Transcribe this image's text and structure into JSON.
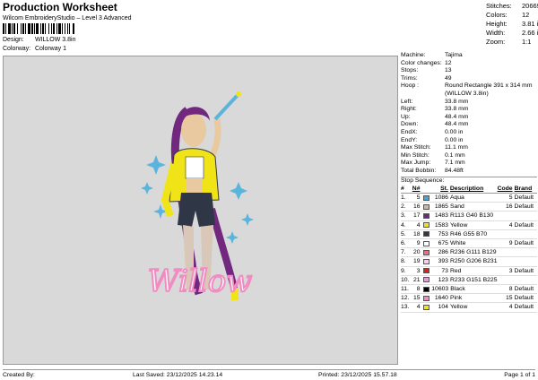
{
  "header": {
    "title": "Production Worksheet",
    "subtitle": "Wilcom EmbroideryStudio – Level 3 Advanced",
    "design_label": "Design:",
    "design_value": "WILLOW 3.8in",
    "colorway_label": "Colorway:",
    "colorway_value": "Colorway 1"
  },
  "summary": [
    {
      "label": "Stitches:",
      "value": "20669"
    },
    {
      "label": "Colors:",
      "value": "12"
    },
    {
      "label": "Height:",
      "value": "3.81 in"
    },
    {
      "label": "Width:",
      "value": "2.66 in"
    },
    {
      "label": "Zoom:",
      "value": "1:1"
    }
  ],
  "properties": [
    {
      "label": "Machine:",
      "value": "Tajima"
    },
    {
      "label": "Color changes:",
      "value": "12"
    },
    {
      "label": "Stops:",
      "value": "13"
    },
    {
      "label": "Trims:",
      "value": "49"
    },
    {
      "label": "Hoop :",
      "value": "Round Rectangle 391 x 314 mm"
    }
  ],
  "hoop_extra": "(WILLOW 3.8in)",
  "properties2": [
    {
      "label": "Left:",
      "value": "33.8 mm"
    },
    {
      "label": "Right:",
      "value": "33.8 mm"
    },
    {
      "label": "Up:",
      "value": "48.4 mm"
    },
    {
      "label": "Down:",
      "value": "48.4 mm"
    },
    {
      "label": "EndX:",
      "value": "0.00 in"
    },
    {
      "label": "EndY:",
      "value": "0.00 in"
    },
    {
      "label": "Max Stitch:",
      "value": "11.1 mm"
    },
    {
      "label": "Min Stitch:",
      "value": "0.1 mm"
    },
    {
      "label": "Max Jump:",
      "value": "7.1 mm"
    },
    {
      "label": "Total Bobbin:",
      "value": "84.48ft"
    }
  ],
  "stop_sequence": {
    "title": "Stop Sequence:",
    "headers": {
      "num": "#",
      "n": "N#",
      "st": "St.",
      "desc": "Description",
      "code": "Code",
      "brand": "Brand"
    },
    "rows": [
      {
        "num": "1.",
        "n": "5",
        "color": "#4aa3d6",
        "st": "1086",
        "desc": "Aqua",
        "code": "5",
        "brand": "Default"
      },
      {
        "num": "2.",
        "n": "16",
        "color": "#c9b89a",
        "st": "1865",
        "desc": "Sand",
        "code": "16",
        "brand": "Default"
      },
      {
        "num": "3.",
        "n": "17",
        "color": "#71287e",
        "st": "1483",
        "desc": "R113 G40 B130",
        "code": "",
        "brand": ""
      },
      {
        "num": "4.",
        "n": "4",
        "color": "#f0e318",
        "st": "1583",
        "desc": "Yellow",
        "code": "4",
        "brand": "Default"
      },
      {
        "num": "5.",
        "n": "18",
        "color": "#2f3746",
        "st": "753",
        "desc": "R46 G55 B70",
        "code": "",
        "brand": ""
      },
      {
        "num": "6.",
        "n": "9",
        "color": "#ffffff",
        "st": "675",
        "desc": "White",
        "code": "9",
        "brand": "Default"
      },
      {
        "num": "7.",
        "n": "20",
        "color": "#ec6f81",
        "st": "286",
        "desc": "R236 G111 B129",
        "code": "",
        "brand": ""
      },
      {
        "num": "8.",
        "n": "19",
        "color": "#facee7",
        "st": "393",
        "desc": "R250 G206 B231",
        "code": "",
        "brand": ""
      },
      {
        "num": "9.",
        "n": "3",
        "color": "#d9201f",
        "st": "73",
        "desc": "Red",
        "code": "3",
        "brand": "Default"
      },
      {
        "num": "10.",
        "n": "21",
        "color": "#e997e1",
        "st": "123",
        "desc": "R233 G151 B225",
        "code": "",
        "brand": ""
      },
      {
        "num": "11.",
        "n": "8",
        "color": "#000000",
        "st": "10603",
        "desc": "Black",
        "code": "8",
        "brand": "Default"
      },
      {
        "num": "12.",
        "n": "15",
        "color": "#f08cc2",
        "st": "1640",
        "desc": "Pink",
        "code": "15",
        "brand": "Default"
      },
      {
        "num": "13.",
        "n": "4",
        "color": "#f0e318",
        "st": "104",
        "desc": "Yellow",
        "code": "4",
        "brand": "Default"
      }
    ]
  },
  "design_text": "Willow",
  "footer": {
    "created_by": "Created By:",
    "last_saved": "Last Saved: 23/12/2025 14.23.14",
    "printed": "Printed: 23/12/2025 15.57.18",
    "page": "Page 1 of 1"
  }
}
